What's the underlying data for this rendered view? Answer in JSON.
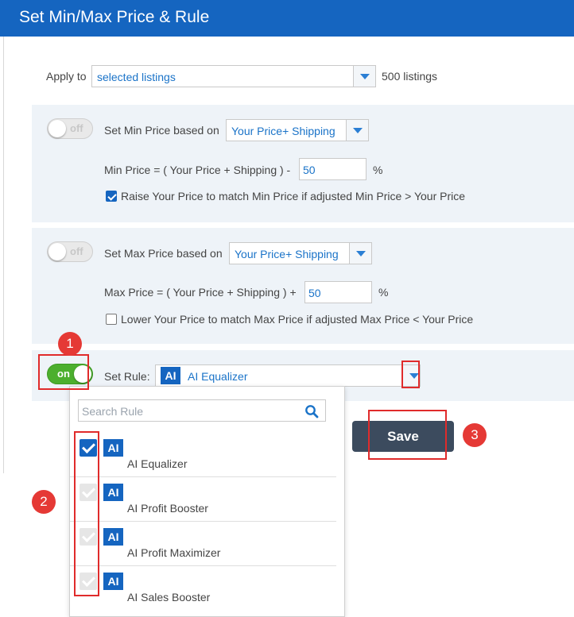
{
  "header": {
    "title": "Set Min/Max Price & Rule"
  },
  "apply": {
    "label": "Apply to",
    "selected": "selected listings",
    "count_text": "500 listings"
  },
  "min_panel": {
    "toggle_text": "off",
    "label": "Set Min Price based on",
    "basis": "Your Price+ Shipping",
    "formula": "Min Price = ( Your Price + Shipping ) -",
    "value": "50",
    "unit": "%",
    "checkbox_label": "Raise Your Price to match Min Price if adjusted Min Price > Your Price",
    "checkbox_checked": true
  },
  "max_panel": {
    "toggle_text": "off",
    "label": "Set Max Price based on",
    "basis": "Your Price+ Shipping",
    "formula": "Max Price = ( Your Price + Shipping ) +",
    "value": "50",
    "unit": "%",
    "checkbox_label": "Lower Your Price to match Max Price if adjusted Max Price < Your Price",
    "checkbox_checked": false
  },
  "rule_panel": {
    "toggle_text": "on",
    "label": "Set Rule:",
    "badge": "AI",
    "selected": "AI Equalizer"
  },
  "dropdown": {
    "search_placeholder": "Search Rule",
    "items": [
      {
        "badge": "AI",
        "name": "AI Equalizer",
        "checked": true
      },
      {
        "badge": "AI",
        "name": "AI Profit Booster",
        "checked": false
      },
      {
        "badge": "AI",
        "name": "AI Profit Maximizer",
        "checked": false
      },
      {
        "badge": "AI",
        "name": "AI Sales Booster",
        "checked": false
      }
    ]
  },
  "save_label": "Save",
  "markers": [
    "1",
    "2",
    "3"
  ],
  "colors": {
    "header": "#1565c0",
    "toggle_on": "#4caf2e",
    "save": "#3c4b5e",
    "annotation": "#e02b2b"
  }
}
